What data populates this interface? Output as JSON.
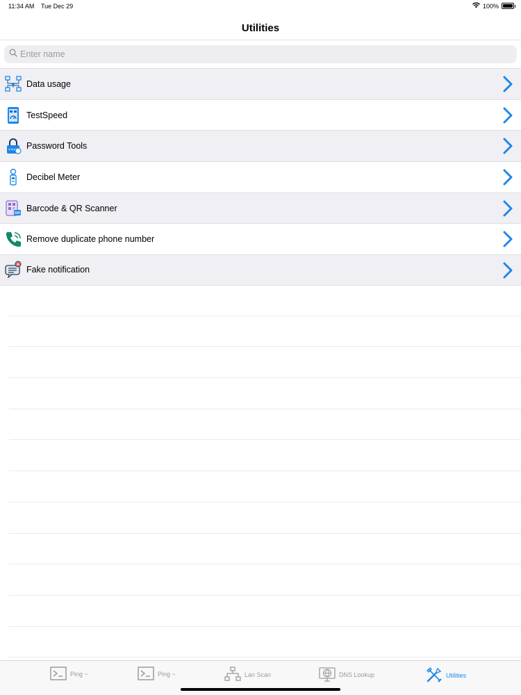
{
  "status_bar": {
    "time": "11:34 AM",
    "date": "Tue Dec 29",
    "battery_percent": "100%",
    "battery_level": 1.0,
    "wifi_icon": "wifi-icon",
    "battery_icon": "battery-icon"
  },
  "nav": {
    "title": "Utilities"
  },
  "search": {
    "placeholder": "Enter name",
    "value": "",
    "icon": "search-icon"
  },
  "utilities": [
    {
      "label": "Data usage",
      "icon": "data-usage-icon"
    },
    {
      "label": "TestSpeed",
      "icon": "speedtest-icon"
    },
    {
      "label": "Password Tools",
      "icon": "password-lock-icon"
    },
    {
      "label": "Decibel Meter",
      "icon": "decibel-meter-icon"
    },
    {
      "label": "Barcode & QR Scanner",
      "icon": "qr-scanner-icon"
    },
    {
      "label": "Remove duplicate phone number",
      "icon": "phone-icon"
    },
    {
      "label": "Fake notification",
      "icon": "notification-icon"
    }
  ],
  "tab_bar": {
    "tabs": [
      {
        "label": "Ping ~",
        "icon": "terminal-icon",
        "active": false
      },
      {
        "label": "Ping ~",
        "icon": "terminal-icon",
        "active": false
      },
      {
        "label": "Lan Scan",
        "icon": "network-icon",
        "active": false
      },
      {
        "label": "DNS Lookup",
        "icon": "globe-monitor-icon",
        "active": false
      },
      {
        "label": "Utilities",
        "icon": "tools-icon",
        "active": true
      }
    ]
  },
  "colors": {
    "accent": "#1e88e5",
    "row_alt": "#efeff4",
    "tab_inactive": "#9a9aa0"
  }
}
